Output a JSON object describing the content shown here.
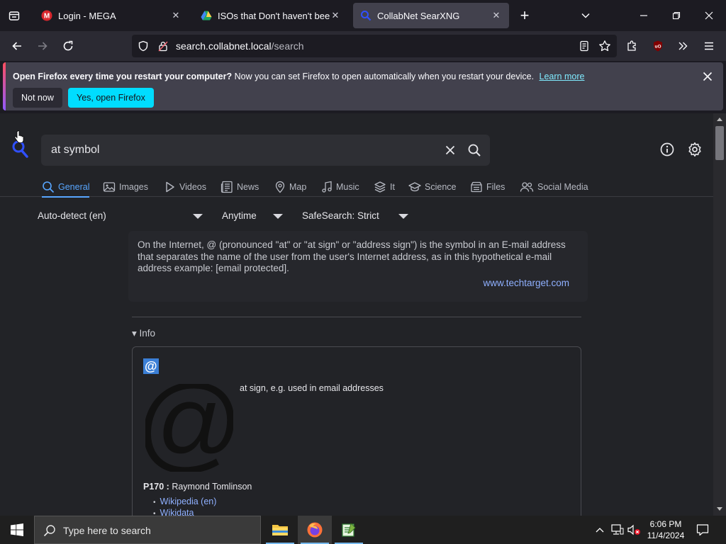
{
  "browser": {
    "tabs": [
      {
        "title": "Login - MEGA",
        "active": false
      },
      {
        "title": "ISOs that Don't haven't been up",
        "active": false
      },
      {
        "title": "CollabNet SearXNG",
        "active": true
      }
    ],
    "url": {
      "host": "search.collabnet.local",
      "path": "/search"
    }
  },
  "notification": {
    "bold_text": "Open Firefox every time you restart your computer?",
    "text": "Now you can set Firefox to open automatically when you restart your device.",
    "learn_more": "Learn more",
    "not_now": "Not now",
    "yes_open": "Yes, open Firefox"
  },
  "search": {
    "query": "at symbol",
    "categories": [
      "General",
      "Images",
      "Videos",
      "News",
      "Map",
      "Music",
      "It",
      "Science",
      "Files",
      "Social Media"
    ],
    "active_category": "General",
    "filters": {
      "language": "Auto-detect (en)",
      "time": "Anytime",
      "safesearch": "SafeSearch: Strict"
    }
  },
  "answer": {
    "text": "On the Internet, @ (pronounced \"at\" or \"at sign\" or \"address sign\") is the symbol in an E-mail address that separates the name of the user from the user's Internet address, as in this hypothetical e-mail address example: [email protected].",
    "source": "www.techtarget.com"
  },
  "infobox": {
    "section": "Info",
    "title": "@",
    "image_glyph": "@",
    "description": "at sign, e.g. used in email addresses",
    "property_key": "P170 :",
    "property_value": "Raymond Tomlinson",
    "links": [
      "Wikipedia (en)",
      "Wikidata"
    ]
  },
  "taskbar": {
    "search_placeholder": "Type here to search",
    "time": "6:06 PM",
    "date": "11/4/2024"
  }
}
